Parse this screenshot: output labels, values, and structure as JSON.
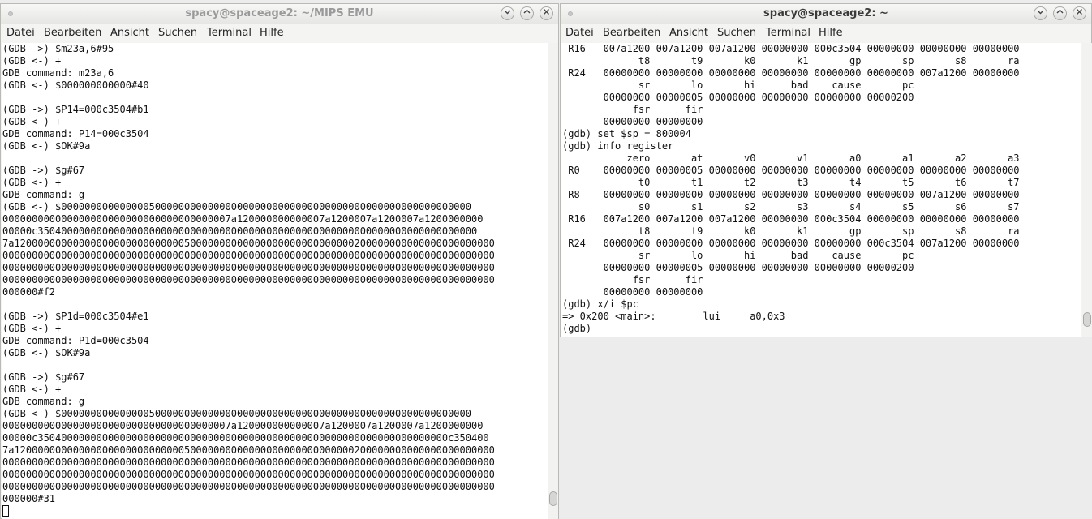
{
  "left_window": {
    "title": "spacy@spaceage2: ~/MIPS EMU",
    "menu": [
      "Datei",
      "Bearbeiten",
      "Ansicht",
      "Suchen",
      "Terminal",
      "Hilfe"
    ],
    "lines": [
      "(GDB ->) $m23a,6#95",
      "(GDB <-) +",
      "GDB command: m23a,6",
      "(GDB <-) $000000000000#40",
      "",
      "(GDB ->) $P14=000c3504#b1",
      "(GDB <-) +",
      "GDB command: P14=000c3504",
      "(GDB <-) $OK#9a",
      "",
      "(GDB ->) $g#67",
      "(GDB <-) +",
      "GDB command: g",
      "(GDB <-) $0000000000000005000000000000000000000000000000000000000000000000000000",
      "000000000000000000000000000000000000007a120000000000007a1200007a1200007a1200000000",
      "00000c350400000000000000000000000000000000000000000000000000000000000000000000000",
      "7a1200000000000000000000000000050000000000000000000000000000200000000000000000000000",
      "000000000000000000000000000000000000000000000000000000000000000000000000000000000000",
      "000000000000000000000000000000000000000000000000000000000000000000000000000000000000",
      "000000000000000000000000000000000000000000000000000000000000000000000000000000000000",
      "000000#f2",
      "",
      "(GDB ->) $P1d=000c3504#e1",
      "(GDB <-) +",
      "GDB command: P1d=000c3504",
      "(GDB <-) $OK#9a",
      "",
      "(GDB ->) $g#67",
      "(GDB <-) +",
      "GDB command: g",
      "(GDB <-) $0000000000000005000000000000000000000000000000000000000000000000000000",
      "000000000000000000000000000000000000007a120000000000007a1200007a1200007a1200000000",
      "00000c3504000000000000000000000000000000000000000000000000000000000000000000c350400",
      "7a1200000000000000000000000000050000000000000000000000000000200000000000000000000000",
      "000000000000000000000000000000000000000000000000000000000000000000000000000000000000",
      "000000000000000000000000000000000000000000000000000000000000000000000000000000000000",
      "000000000000000000000000000000000000000000000000000000000000000000000000000000000000",
      "000000#31"
    ]
  },
  "right_window": {
    "title": "spacy@spaceage2: ~",
    "menu": [
      "Datei",
      "Bearbeiten",
      "Ansicht",
      "Suchen",
      "Terminal",
      "Hilfe"
    ],
    "lines": [
      " R16   007a1200 007a1200 007a1200 00000000 000c3504 00000000 00000000 00000000",
      "             t8       t9       k0       k1       gp       sp       s8       ra",
      " R24   00000000 00000000 00000000 00000000 00000000 00000000 007a1200 00000000",
      "             sr       lo       hi      bad    cause       pc",
      "       00000000 00000005 00000000 00000000 00000000 00000200",
      "            fsr      fir",
      "       00000000 00000000",
      "(gdb) set $sp = 800004",
      "(gdb) info register",
      "           zero       at       v0       v1       a0       a1       a2       a3",
      " R0    00000000 00000005 00000000 00000000 00000000 00000000 00000000 00000000",
      "             t0       t1       t2       t3       t4       t5       t6       t7",
      " R8    00000000 00000000 00000000 00000000 00000000 00000000 007a1200 00000000",
      "             s0       s1       s2       s3       s4       s5       s6       s7",
      " R16   007a1200 007a1200 007a1200 00000000 000c3504 00000000 00000000 00000000",
      "             t8       t9       k0       k1       gp       sp       s8       ra",
      " R24   00000000 00000000 00000000 00000000 00000000 000c3504 007a1200 00000000",
      "             sr       lo       hi      bad    cause       pc",
      "       00000000 00000005 00000000 00000000 00000000 00000200",
      "            fsr      fir",
      "       00000000 00000000",
      "(gdb) x/i $pc",
      "=> 0x200 <main>:        lui     a0,0x3",
      "(gdb) "
    ]
  },
  "icons": {
    "minimize": "chevron-down-icon",
    "maximize": "chevron-up-icon",
    "close": "close-icon"
  }
}
